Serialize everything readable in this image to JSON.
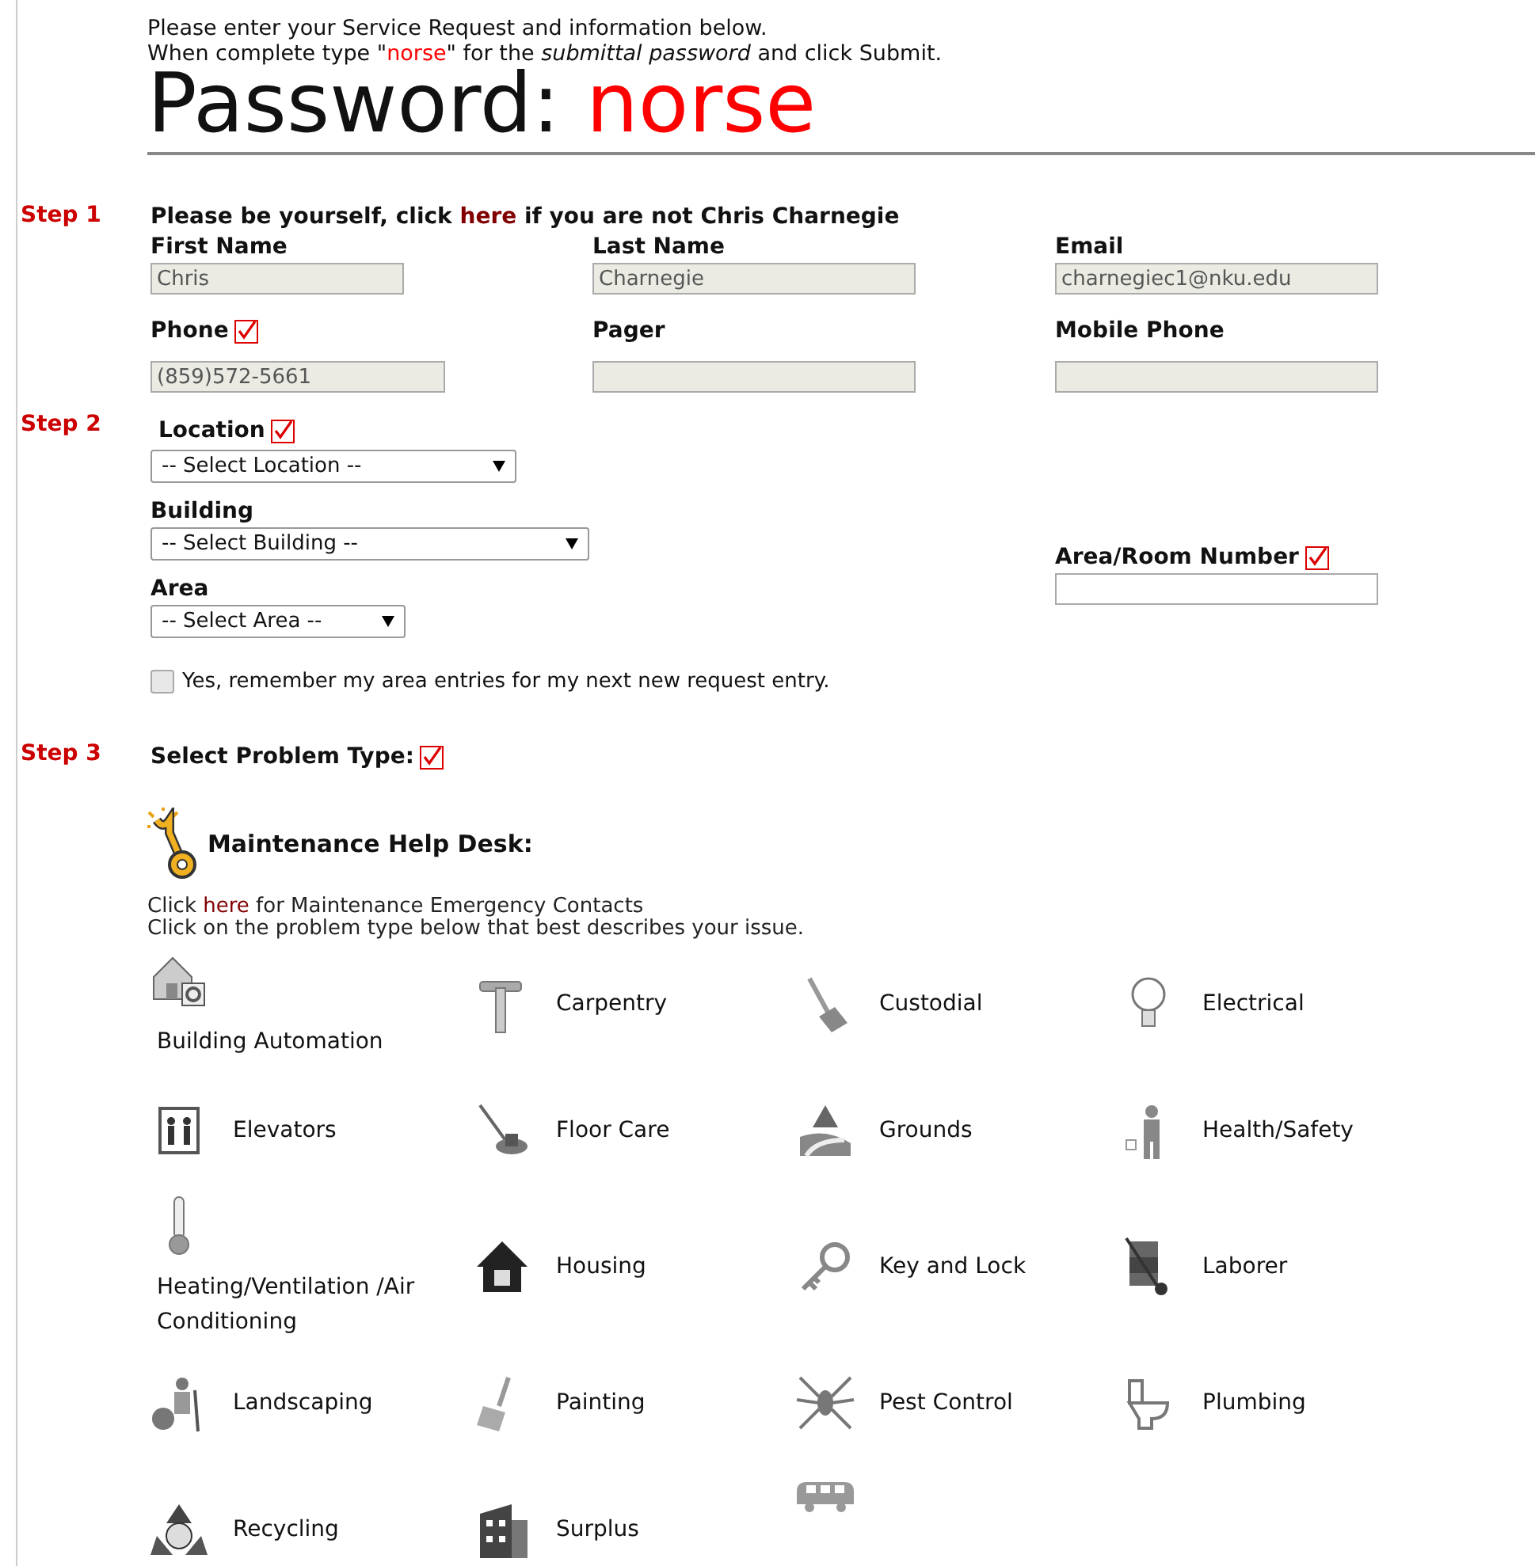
{
  "intro": {
    "line_1": "Please enter your Service Request and information below.",
    "line_2_before": "When complete type \"",
    "line_2_word": "norse",
    "line_2_after": "\" for the *submittal password* and click Submit.",
    "password_label": "Password:",
    "password": "norse"
  },
  "step_1": {
    "step": "Step 1",
    "notice_before": "Please be yourself, click",
    "link": "here",
    "notice_after": "if you are not Chris Charnegie",
    "fields": [
      {
        "label": "First Name",
        "value": "Chris",
        "disabled": true,
        "required": false
      },
      {
        "label": "Last Name",
        "value": "Charnegie",
        "disabled": true,
        "required": false
      },
      {
        "label": "Email",
        "value": "charnegiec1@nku.edu",
        "disabled": true,
        "required": false
      },
      {
        "label": "Phone",
        "value": "(859)572-5661",
        "disabled": true,
        "required": true
      },
      {
        "label": "Pager",
        "disabled": true,
        "required": false
      },
      {
        "label": "Mobile Phone",
        "disabled": true,
        "required": false
      }
    ]
  },
  "step_2": {
    "step": "Step 2",
    "selects": [
      {
        "label": "Location",
        "value": "-- Select Location --",
        "required": true
      },
      {
        "label": "Building",
        "value": "-- Select Building --",
        "required": false
      },
      {
        "label": "Area",
        "value": "-- Select Area --",
        "required": false
      }
    ],
    "room": {
      "label": "Area/Room Number",
      "required": true,
      "disabled": false
    },
    "remember": {
      "label": "Yes, remember my area entries for my next new request entry.",
      "checked": false
    }
  },
  "step_3": {
    "step": "Step 3",
    "label": "Select Problem Type:",
    "required": true,
    "desk_title": "Maintenance Help Desk:",
    "contacts_before": "Click",
    "contacts_link": "here",
    "contacts_after": "for Maintenance Emergency Contacts",
    "instruction": "Click on the problem type below that best describes your issue.",
    "problem_types": [
      {
        "label": "Building Automation",
        "kind": "stacked"
      },
      {
        "label": "Carpentry",
        "kind": "inline"
      },
      {
        "label": "Custodial",
        "kind": "inline"
      },
      {
        "label": "Electrical",
        "kind": "inline"
      },
      {
        "label": "Elevators",
        "kind": "inline"
      },
      {
        "label": "Floor Care",
        "kind": "inline"
      },
      {
        "label": "Grounds",
        "kind": "inline"
      },
      {
        "label": "Health/Safety",
        "kind": "inline"
      },
      {
        "label": "Heating/Ventilation /Air Conditioning",
        "kind": "stacked"
      },
      {
        "label": "Housing",
        "kind": "inline"
      },
      {
        "label": "Key and Lock",
        "kind": "inline"
      },
      {
        "label": "Laborer",
        "kind": "inline"
      },
      {
        "label": "Landscaping",
        "kind": "inline"
      },
      {
        "label": "Painting",
        "kind": "inline"
      },
      {
        "label": "Pest Control",
        "kind": "inline"
      },
      {
        "label": "Plumbing",
        "kind": "inline"
      },
      {
        "label": "Recycling",
        "kind": "inline"
      },
      {
        "label": "Surplus",
        "kind": "inline"
      },
      {
        "kind": "icon_only"
      }
    ]
  }
}
